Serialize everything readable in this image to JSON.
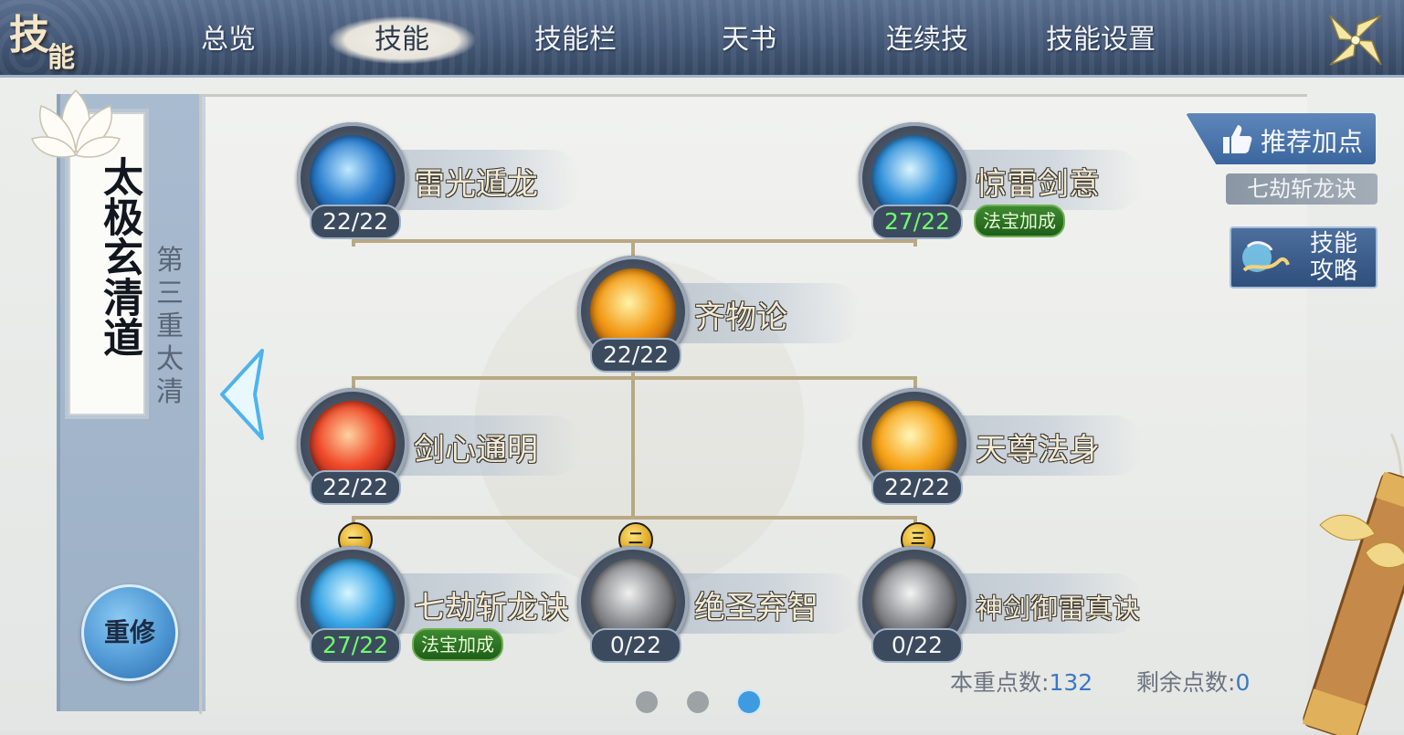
{
  "window": {
    "title_chars": [
      "技",
      "能"
    ],
    "close_label": "close"
  },
  "tabs": [
    {
      "label": "总览",
      "active": false
    },
    {
      "label": "技能",
      "active": true
    },
    {
      "label": "技能栏",
      "active": false
    },
    {
      "label": "天书",
      "active": false
    },
    {
      "label": "连续技",
      "active": false
    },
    {
      "label": "技能设置",
      "active": false
    }
  ],
  "sidebar": {
    "school_title": "太极玄清道",
    "tier_label": [
      "第",
      "三",
      "重",
      "太",
      "清"
    ],
    "reset_label": "重修"
  },
  "skills": [
    {
      "name": "雷光遁龙",
      "level": "22/22",
      "boosted": false,
      "bonus": "",
      "icon": "lightning-orb-icon",
      "colors": [
        "#bfe9ff",
        "#2c7fcf",
        "#0b2f66"
      ]
    },
    {
      "name": "惊雷剑意",
      "level": "27/22",
      "boosted": true,
      "bonus": "法宝加成",
      "icon": "triple-sword-icon",
      "colors": [
        "#d9f4ff",
        "#2f8fd9",
        "#0c2f6a"
      ]
    },
    {
      "name": "齐物论",
      "level": "22/22",
      "boosted": false,
      "bonus": "",
      "icon": "golden-shield-icon",
      "colors": [
        "#fff3a8",
        "#f39a16",
        "#8a3506"
      ]
    },
    {
      "name": "剑心通明",
      "level": "22/22",
      "boosted": false,
      "bonus": "",
      "icon": "flame-blade-icon",
      "colors": [
        "#ffd2a1",
        "#ef4a2a",
        "#6e0c0a"
      ]
    },
    {
      "name": "天尊法身",
      "level": "22/22",
      "boosted": false,
      "bonus": "",
      "icon": "golden-burst-icon",
      "colors": [
        "#fff6b8",
        "#f7a51b",
        "#8b4b08"
      ]
    },
    {
      "name": "七劫斩龙诀",
      "level": "27/22",
      "boosted": true,
      "bonus": "法宝加成",
      "icon": "ice-dragon-icon",
      "colors": [
        "#d5f6ff",
        "#3ba6e6",
        "#0c3c78"
      ]
    },
    {
      "name": "绝圣弃智",
      "level": "0/22",
      "boosted": false,
      "bonus": "",
      "icon": "grey-dragon-icon",
      "colors": [
        "#f0f0f0",
        "#8b8d90",
        "#2a2b2e"
      ]
    },
    {
      "name": "神剑御雷真诀",
      "level": "0/22",
      "boosted": false,
      "bonus": "",
      "icon": "grey-lightning-icon",
      "colors": [
        "#f4f4f4",
        "#8a8c90",
        "#25272a"
      ]
    }
  ],
  "unlock_badges": [
    "一",
    "二",
    "三"
  ],
  "right_panel": {
    "recommend_label": "推荐加点",
    "recommended_skill": "七劫斩龙诀",
    "guide_label_line1": "技能",
    "guide_label_line2": "攻略"
  },
  "points": {
    "tier_points_label": "本重点数:",
    "tier_points_value": "132",
    "remaining_label": "剩余点数:",
    "remaining_value": "0"
  },
  "pagination": {
    "total": 3,
    "current": 3
  },
  "colors": {
    "topbar": "#425675",
    "accent_blue": "#3e9be0",
    "bonus_green": "#2f7a25",
    "boosted_level": "#6dff6a"
  }
}
